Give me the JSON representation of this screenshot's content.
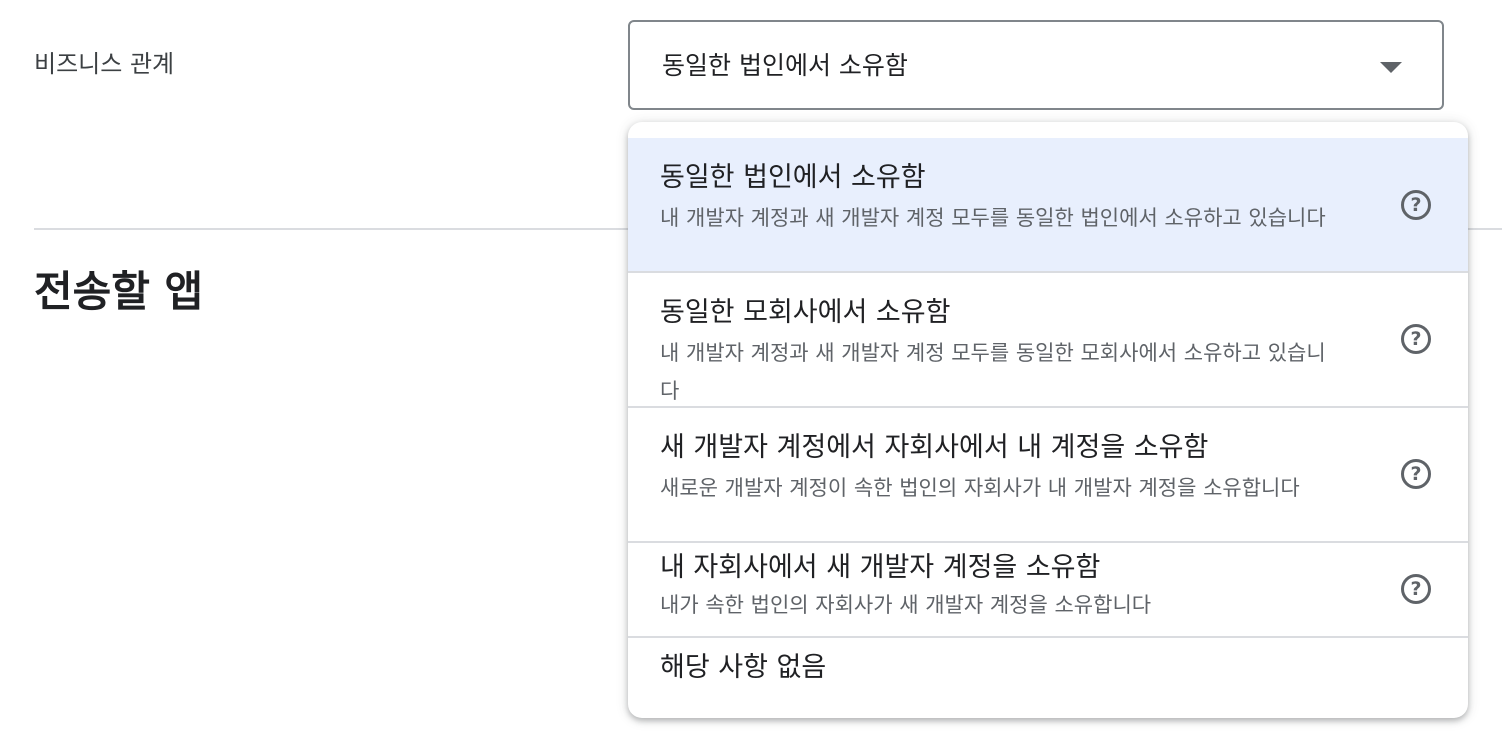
{
  "form": {
    "business_relationship_label": "비즈니스 관계",
    "selected_value": "동일한 법인에서 소유함",
    "dropdown_icon": "caret-down-icon"
  },
  "section": {
    "title": "전송할 앱"
  },
  "colors": {
    "selected_option_bg": "#e8effd",
    "divider": "#dadce0",
    "text_primary": "#202124",
    "text_secondary": "#5f6368"
  },
  "menu": {
    "options": [
      {
        "title": "동일한 법인에서 소유함",
        "description": "내 개발자 계정과 새 개발자 계정 모두를 동일한 법인에서 소유하고 있습니다",
        "icon": "help-circle-icon",
        "selected": true
      },
      {
        "title": "동일한 모회사에서 소유함",
        "description": "내 개발자 계정과 새 개발자 계정 모두를 동일한 모회사에서 소유하고 있습니다",
        "icon": "help-circle-icon",
        "selected": false
      },
      {
        "title": "새 개발자 계정에서 자회사에서 내 계정을 소유함",
        "description": "새로운 개발자 계정이 속한 법인의 자회사가 내 개발자 계정을 소유합니다",
        "icon": "help-circle-icon",
        "selected": false
      },
      {
        "title": "내 자회사에서 새 개발자 계정을 소유함",
        "description": "내가 속한 법인의 자회사가 새 개발자 계정을 소유합니다",
        "icon": "help-circle-icon",
        "selected": false
      },
      {
        "title": "해당 사항 없음",
        "selected": false
      }
    ]
  }
}
